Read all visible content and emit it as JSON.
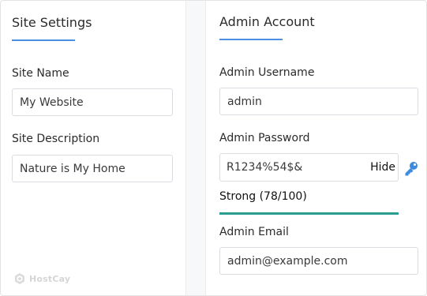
{
  "site_settings": {
    "heading": "Site Settings",
    "site_name": {
      "label": "Site Name",
      "value": "My Website"
    },
    "site_description": {
      "label": "Site Description",
      "value": "Nature is My Home"
    }
  },
  "admin_account": {
    "heading": "Admin Account",
    "username": {
      "label": "Admin Username",
      "value": "admin"
    },
    "password": {
      "label": "Admin Password",
      "value": "R1234%54$&",
      "toggle_label": "Hide",
      "key_icon": "key-icon"
    },
    "strength": {
      "text": "Strong (78/100)",
      "score": 78,
      "color": "#2a9d8f"
    },
    "email": {
      "label": "Admin Email",
      "value": "admin@example.com"
    }
  },
  "watermark": {
    "text": "HostCay"
  },
  "colors": {
    "accent": "#4a8fe0",
    "strength_bar": "#2a9d8f",
    "key_icon": "#3d8be0"
  }
}
